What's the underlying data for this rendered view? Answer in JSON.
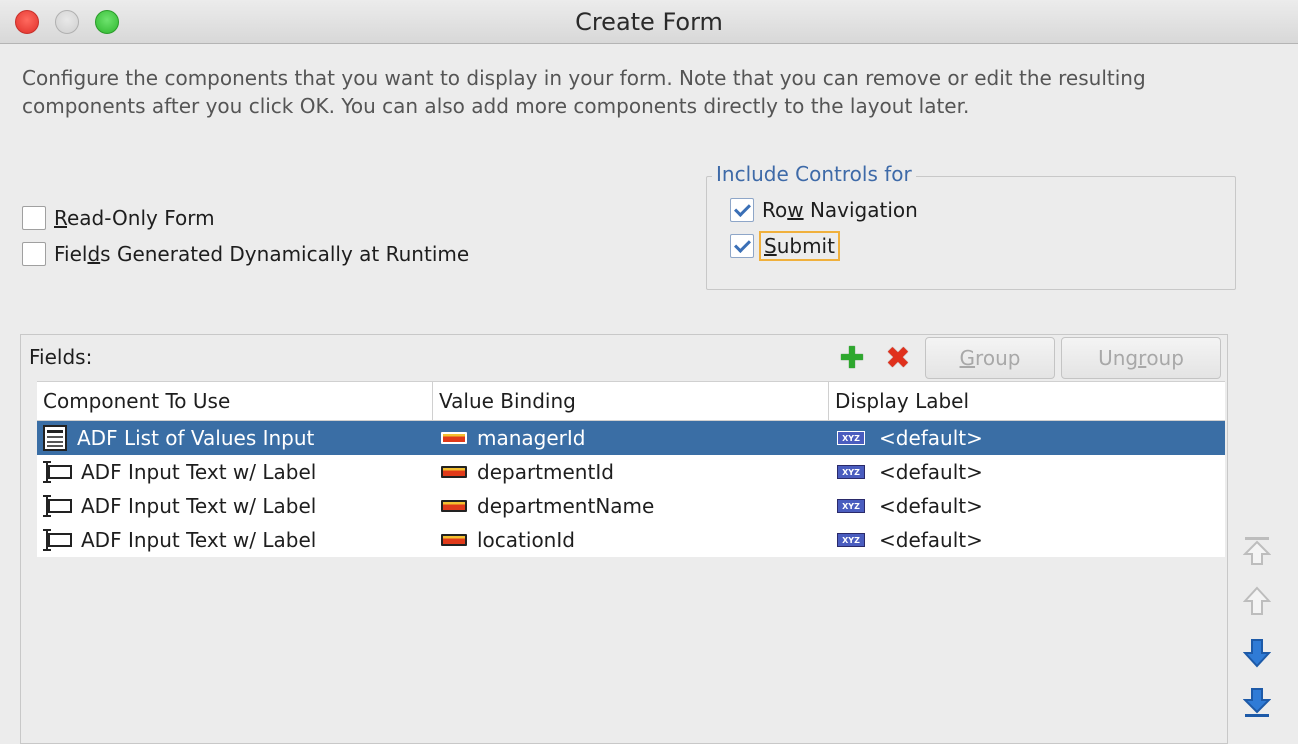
{
  "window": {
    "title": "Create Form"
  },
  "description": "Configure the components that you want to display in your form. Note that you can remove or edit the resulting components after you click OK. You can also add more components directly to the layout later.",
  "options": {
    "read_only_form": {
      "label_mnemonic": "R",
      "label_rest": "ead-Only Form",
      "checked": false
    },
    "fields_dynamic": {
      "label_pre": "Fiel",
      "label_mnemonic": "d",
      "label_rest": "s Generated Dynamically at Runtime",
      "checked": false
    }
  },
  "include_controls": {
    "legend": "Include Controls for",
    "row_navigation": {
      "label_pre": "Ro",
      "label_mnemonic": "w",
      "label_rest": " Navigation",
      "checked": true
    },
    "submit": {
      "label_mnemonic": "S",
      "label_rest": "ubmit",
      "checked": true
    }
  },
  "fields": {
    "header": "Fields:",
    "group_button": {
      "mnemonic": "G",
      "rest": "roup"
    },
    "ungroup_button": {
      "pre": "Ung",
      "mnemonic": "r",
      "rest": "oup"
    },
    "columns": [
      "Component To Use",
      "Value Binding",
      "Display Label"
    ],
    "rows": [
      {
        "component": "ADF List of Values Input",
        "component_icon": "list-of-values-icon",
        "binding": "managerId",
        "label": "<default>",
        "selected": true
      },
      {
        "component": "ADF Input Text w/ Label",
        "component_icon": "input-text-icon",
        "binding": "departmentId",
        "label": "<default>",
        "selected": false
      },
      {
        "component": "ADF Input Text w/ Label",
        "component_icon": "input-text-icon",
        "binding": "departmentName",
        "label": "<default>",
        "selected": false
      },
      {
        "component": "ADF Input Text w/ Label",
        "component_icon": "input-text-icon",
        "binding": "locationId",
        "label": "<default>",
        "selected": false
      }
    ],
    "label_icon_text": "XYZ"
  },
  "colors": {
    "selection": "#3a6ea5",
    "legend": "#3e6aa8",
    "add": "#2ea82e",
    "remove": "#e0301c",
    "arrow_active": "#2f7bd6"
  }
}
